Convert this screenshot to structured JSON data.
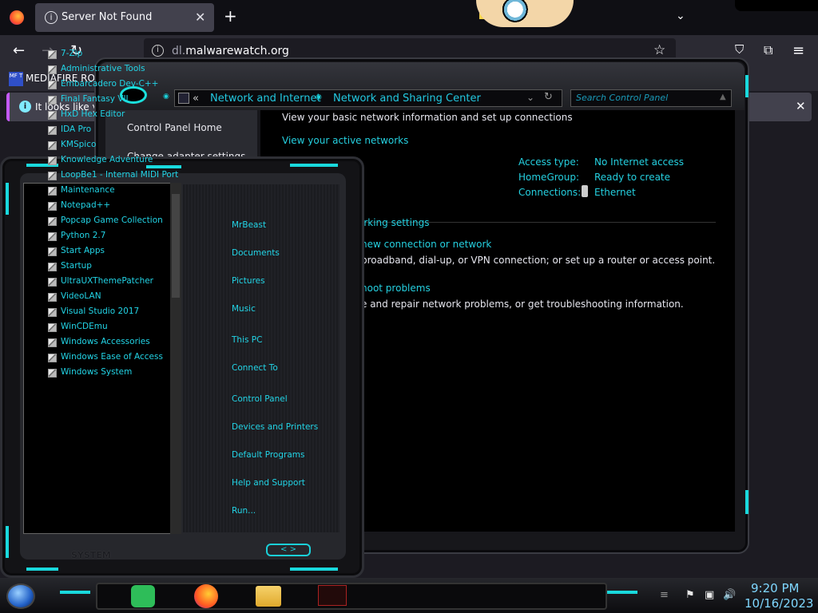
{
  "browser": {
    "tab_title": "Server Not Found",
    "url_host": "dl.",
    "url_domain": "malwarewatch.org",
    "bookmark_label": "MEDIAFIRE RO",
    "bookmark_icon_text": "MF T",
    "info_text": "It looks like y"
  },
  "control_panel": {
    "breadcrumb": [
      "«",
      "Network and Internet",
      "Network and Sharing Center"
    ],
    "search_placeholder": "Search Control Panel",
    "sidebar": [
      "Control Panel Home",
      "Change adapter settings"
    ],
    "heading": "View your basic network information and set up connections",
    "active_networks": "View your active networks",
    "access_type_label": "Access type:",
    "access_type_value": "No Internet access",
    "homegroup_label": "HomeGroup:",
    "homegroup_value": "Ready to create",
    "connections_label": "Connections:",
    "connections_value": "Ethernet",
    "change_settings": "orking settings",
    "new_connection": "new connection or network",
    "new_connection_desc": "broadband, dial-up, or VPN connection; or set up a router or access point.",
    "troubleshoot": "hoot problems",
    "troubleshoot_desc": "e and repair network problems, or get troubleshooting information."
  },
  "start_menu": {
    "programs": [
      "7-Zip",
      "Administrative Tools",
      "Embarcadero Dev-C++",
      "Final Fantasy VII",
      "HxD Hex Editor",
      "IDA Pro",
      "KMSpico",
      "Knowledge Adventure",
      "LoopBe1 - Internal MIDI Port",
      "Maintenance",
      "Notepad++",
      "Popcap Game Collection",
      "Python 2.7",
      "Start Apps",
      "Startup",
      "UltraUXThemePatcher",
      "VideoLAN",
      "Visual Studio 2017",
      "WinCDEmu",
      "Windows Accessories",
      "Windows Ease of Access",
      "Windows System"
    ],
    "right": [
      "MrBeast",
      "Documents",
      "Pictures",
      "Music",
      "This PC",
      "Connect To",
      "Control Panel",
      "Devices and Printers",
      "Default Programs",
      "Help and Support",
      "Run..."
    ],
    "system_label": "SYSTEM",
    "nav_arrows": "< >"
  },
  "taskbar": {
    "time": "9:20 PM",
    "date": "10/16/2023"
  },
  "colors": {
    "accent": "#22d4e6",
    "browser_bg": "#2b2a33"
  }
}
